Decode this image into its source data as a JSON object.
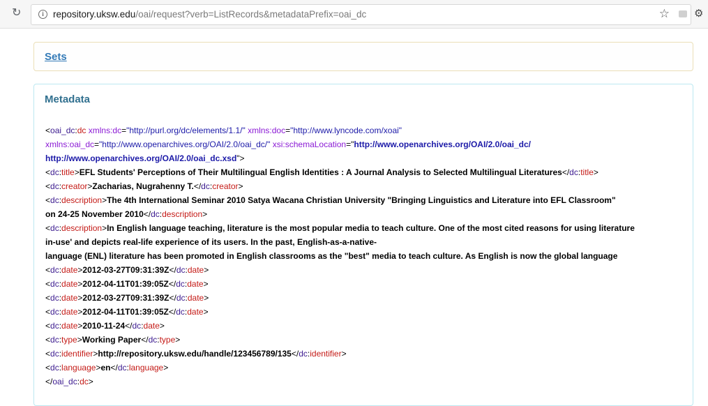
{
  "browser": {
    "url_host": "repository.uksw.edu",
    "url_path": "/oai/request?verb=ListRecords&metadataPrefix=oai_dc"
  },
  "sets": {
    "label": "Sets"
  },
  "metadata": {
    "title": "Metadata",
    "root_open": {
      "prefix": "oai_dc",
      "name": "dc",
      "attr1_name": "xmlns:dc",
      "attr1_value": "\"http://purl.org/dc/elements/1.1/\"",
      "attr2_name": "xmlns:doc",
      "attr2_value": "\"http://www.lyncode.com/xoai\"",
      "attr3_name": "xmlns:oai_dc",
      "attr3_value": "\"http://www.openarchives.org/OAI/2.0/oai_dc/\"",
      "attr4_name": "xsi:schemaLocation",
      "attr4_value_a": "http://www.openarchives.org/OAI/2.0/oai_dc/",
      "attr4_value_b": "http://www.openarchives.org/OAI/2.0/oai_dc.xsd"
    },
    "elements": [
      {
        "tag": "title",
        "value": "EFL Students' Perceptions of Their Multilingual English Identities : A Journal Analysis to Selected Multilingual Literatures"
      },
      {
        "tag": "creator",
        "value": "Zacharias, Nugrahenny T."
      },
      {
        "tag": "description",
        "value": "The 4th International Seminar 2010 Satya Wacana Christian University \"Bringing Linguistics and Literature into EFL Classroom\"",
        "value2": "on 24-25 November 2010"
      },
      {
        "tag": "description",
        "value": "In English language teaching, literature is the most popular media to teach culture. One of the most cited reasons for using literature",
        "value2": "in-use' and depicts real-life experience of its users. In the past, English-as-a-native-",
        "value3": "language (ENL) literature has been promoted in English classrooms as the \"best\" media to teach culture. As English is now the global language"
      },
      {
        "tag": "date",
        "value": "2012-03-27T09:31:39Z"
      },
      {
        "tag": "date",
        "value": "2012-04-11T01:39:05Z"
      },
      {
        "tag": "date",
        "value": "2012-03-27T09:31:39Z"
      },
      {
        "tag": "date",
        "value": "2012-04-11T01:39:05Z"
      },
      {
        "tag": "date",
        "value": "2010-11-24"
      },
      {
        "tag": "type",
        "value": "Working Paper"
      },
      {
        "tag": "identifier",
        "value": "http://repository.uksw.edu/handle/123456789/135"
      },
      {
        "tag": "language",
        "value": "en"
      }
    ],
    "dc_prefix": "dc",
    "root_close_prefix": "oai_dc",
    "root_close_name": "dc"
  }
}
